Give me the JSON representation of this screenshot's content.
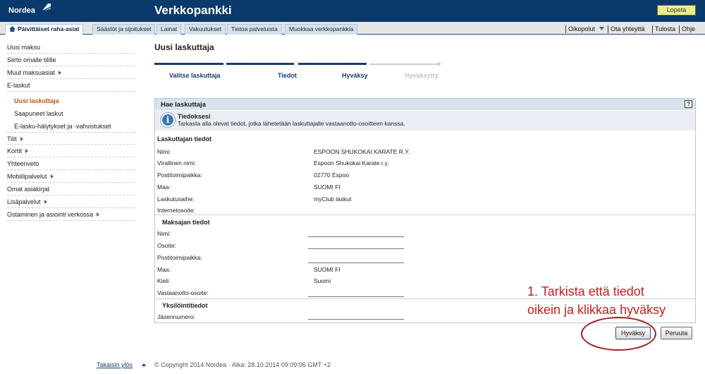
{
  "header": {
    "brand": "Nordea",
    "title": "Verkkopankki",
    "logout_label": "Lopeta"
  },
  "tabs": [
    {
      "label": "Päivittäiset raha-asiat",
      "active": true
    },
    {
      "label": "Säästöt ja sijoitukset"
    },
    {
      "label": "Lainat"
    },
    {
      "label": "Vakuutukset"
    },
    {
      "label": "Tietoa palveluista"
    },
    {
      "label": "Muokkaa verkkopankkia"
    }
  ],
  "utility": {
    "shortcuts": "Oikopolut",
    "contact": "Ota yhteyttä",
    "print": "Tulosta",
    "help": "Ohje"
  },
  "sidebar": {
    "items": [
      {
        "label": "Uusi maksu"
      },
      {
        "label": "Siirto omalle tilille"
      },
      {
        "label": "Muut maksuasiat"
      },
      {
        "label": "E-laskut"
      },
      {
        "label": "Uusi laskuttaja"
      },
      {
        "label": "Saapuneet laskut"
      },
      {
        "label": "E-lasku-hälytykset ja -vahvistukset"
      },
      {
        "label": "Tilit"
      },
      {
        "label": "Kortit"
      },
      {
        "label": "Yhteenveto"
      },
      {
        "label": "Mobiilipalvelut"
      },
      {
        "label": "Omat asiakirjat"
      },
      {
        "label": "Lisäpalvelut"
      },
      {
        "label": "Ostaminen ja asiointi verkossa"
      }
    ]
  },
  "page": {
    "title": "Uusi laskuttaja"
  },
  "steps": [
    {
      "label": "Valitse laskuttaja",
      "status": "done"
    },
    {
      "label": "Tiedot",
      "status": "done"
    },
    {
      "label": "Hyväksy",
      "status": "current"
    },
    {
      "label": "Hyväksytty",
      "status": "future"
    }
  ],
  "panel": {
    "title": "Hae laskuttaja",
    "help": "?",
    "info": {
      "icon": "info-icon",
      "glyph": "i",
      "title": "Tiedoksesi",
      "text": "Tarkasta alla olevat tiedot, jotka lähetetään laskuttajalle vastaanotto-osoitteen kanssa."
    },
    "biller": {
      "heading": "Laskuttajan tiedot",
      "rows": [
        {
          "label": "Nimi:",
          "value": "ESPOON SHUKOKAI KARATE R.Y."
        },
        {
          "label": "Virallinen nimi:",
          "value": "Espoon Shukokai Karate r.y."
        },
        {
          "label": "Postitoimipaikka:",
          "value": "02770 Espoo"
        },
        {
          "label": "Maa:",
          "value": "SUOMI FI"
        },
        {
          "label": "Laskutusaihe:",
          "value": "myClub laskut"
        },
        {
          "label": "Internetosoite:",
          "value": ""
        }
      ]
    },
    "payer": {
      "heading": "Maksajan tiedot",
      "name_label": "Nimi:",
      "name_value": "",
      "address_label": "Osoite:",
      "address_value": "",
      "postal_label": "Postitoimipaikka:",
      "postal_value": "",
      "country_label": "Maa:",
      "country_value": "SUOMI FI",
      "language_label": "Kieli:",
      "language_value": "Suomi",
      "receive_label": "Vastaanotto-osoite:",
      "receive_value": ""
    },
    "ident": {
      "heading": "Yksilöintitiedot",
      "member_label": "Jäsennumero:",
      "member_value": ""
    }
  },
  "buttons": {
    "approve": "Hyväksy",
    "cancel": "Peruuta"
  },
  "annotation": {
    "line1": "1. Tarkista että tiedot",
    "line2": "oikein ja klikkaa hyväksy"
  },
  "footer": {
    "back_to_top": "Takaisin ylös",
    "copyright": "© Copyright 2014 Nordea · Aika: 28.10.2014 09:09:06 GMT +2"
  },
  "colors": {
    "header": "#0a3a6b",
    "accent": "#c2580f",
    "logout": "#e9ee94",
    "annotation": "#c41f1f"
  }
}
